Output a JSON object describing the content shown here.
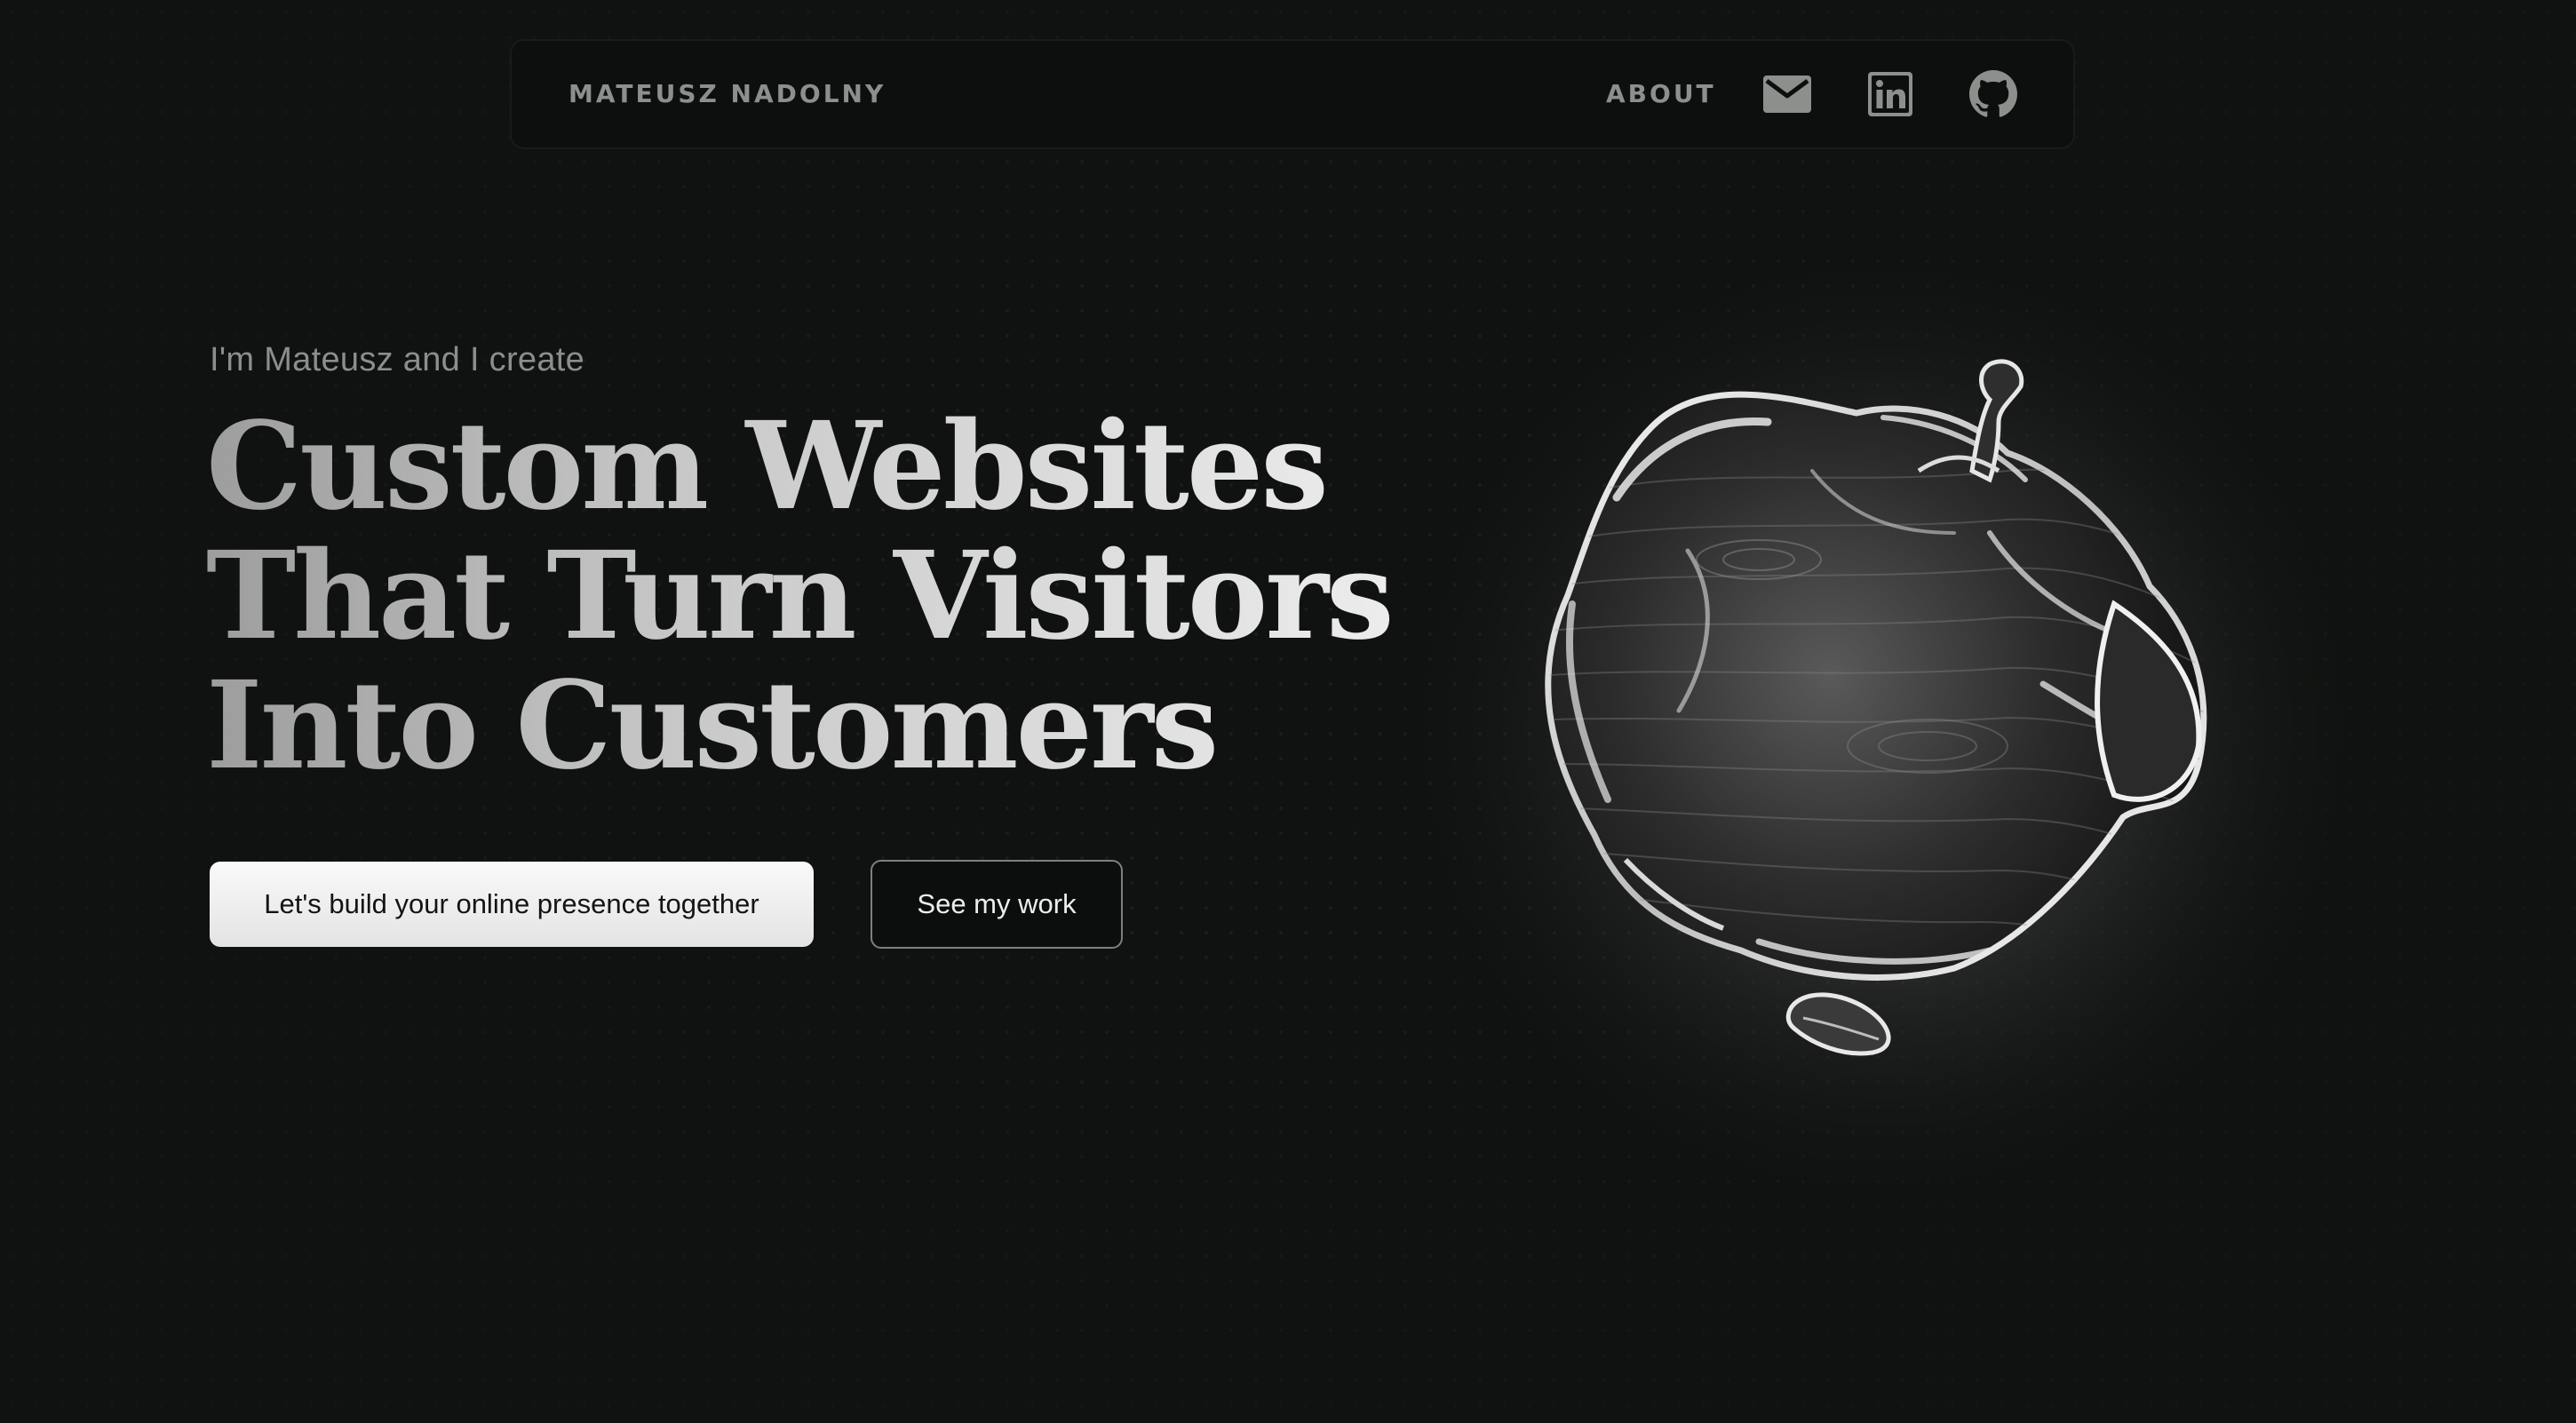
{
  "nav": {
    "brand": "MATEUSZ NADOLNY",
    "about": "ABOUT",
    "icons": [
      "mail-icon",
      "linkedin-icon",
      "github-icon"
    ]
  },
  "hero": {
    "intro": "I'm Mateusz and I create",
    "headline": [
      "Custom Websites",
      "That Turn Visitors",
      "Into Customers"
    ],
    "primary_cta": "Let's build your online presence together",
    "secondary_cta": "See my work"
  },
  "colors": {
    "background": "#101211",
    "nav_text": "#8d8f8d",
    "headline_light": "#ececec",
    "headline_dark": "#9d9d9d",
    "primary_button": "#f2f2f2",
    "secondary_border": "#7e807e"
  }
}
